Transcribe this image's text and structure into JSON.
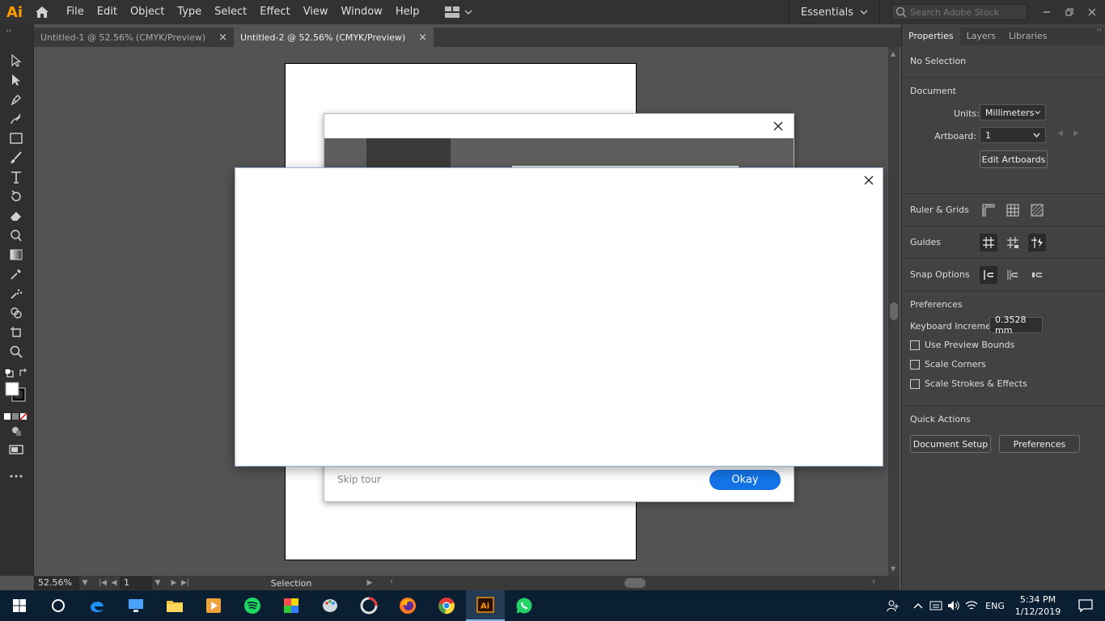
{
  "app": {
    "logo": "Ai"
  },
  "menu": [
    "File",
    "Edit",
    "Object",
    "Type",
    "Select",
    "Effect",
    "View",
    "Window",
    "Help"
  ],
  "workspace": "Essentials",
  "search": {
    "placeholder": "Search Adobe Stock"
  },
  "tabs": [
    {
      "label": "Untitled-1 @ 52.56% (CMYK/Preview)",
      "active": false
    },
    {
      "label": "Untitled-2 @ 52.56% (CMYK/Preview)",
      "active": true
    }
  ],
  "status": {
    "zoom": "52.56%",
    "page": "1",
    "tool": "Selection"
  },
  "panel": {
    "tabs": [
      "Properties",
      "Layers",
      "Libraries"
    ],
    "no_selection": "No Selection",
    "document_title": "Document",
    "units_label": "Units:",
    "units_value": "Millimeters",
    "artboard_label": "Artboard:",
    "artboard_value": "1",
    "edit_artboards": "Edit Artboards",
    "ruler_grids": "Ruler & Grids",
    "guides": "Guides",
    "snap_options": "Snap Options",
    "preferences_title": "Preferences",
    "keyboard_increment_label": "Keyboard Increment:",
    "keyboard_increment_value": "0.3528 mm",
    "use_preview_bounds": "Use Preview Bounds",
    "scale_corners": "Scale Corners",
    "scale_strokes": "Scale Strokes & Effects",
    "quick_actions": "Quick Actions",
    "document_setup": "Document Setup",
    "preferences_btn": "Preferences"
  },
  "tour": {
    "skip": "Skip tour",
    "okay": "Okay"
  },
  "taskbar": {
    "lang": "ENG",
    "time": "5:34 PM",
    "date": "1/12/2019"
  },
  "colors": {
    "ai_orange": "#ff9a00",
    "accent_blue": "#1473e6",
    "taskbar": "#0b1f33"
  }
}
